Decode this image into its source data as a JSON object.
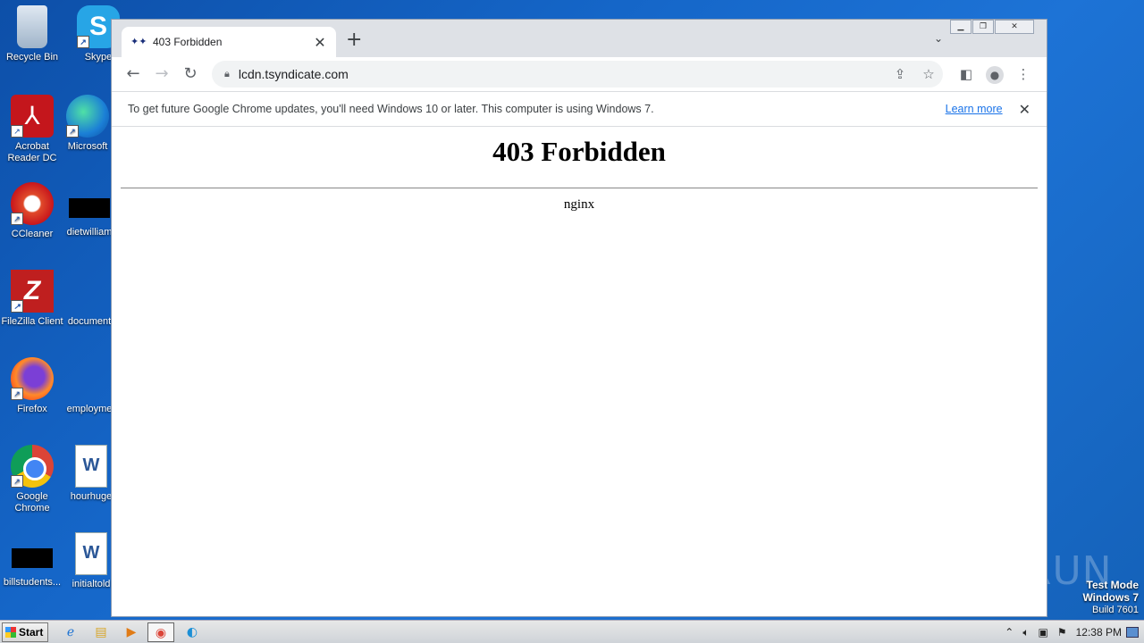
{
  "desktop": {
    "icons": [
      {
        "label": "Recycle Bin",
        "icon": "recycle-bin-icon"
      },
      {
        "label": "Skype",
        "icon": "skype-icon"
      },
      {
        "label": "Acrobat Reader DC",
        "icon": "acrobat-icon"
      },
      {
        "label": "Microsoft",
        "icon": "edge-icon"
      },
      {
        "label": "CCleaner",
        "icon": "ccleaner-icon"
      },
      {
        "label": "dietwilliam",
        "icon": "file-icon"
      },
      {
        "label": "FileZilla Client",
        "icon": "filezilla-icon"
      },
      {
        "label": "document",
        "icon": "file-icon"
      },
      {
        "label": "Firefox",
        "icon": "firefox-icon"
      },
      {
        "label": "employme",
        "icon": "file-icon"
      },
      {
        "label": "Google Chrome",
        "icon": "chrome-icon"
      },
      {
        "label": "hourhuge",
        "icon": "word-doc-icon"
      },
      {
        "label": "billstudents...",
        "icon": "file-icon"
      },
      {
        "label": "initialtold",
        "icon": "word-doc-icon"
      }
    ],
    "watermark": "ANY RUN",
    "test_mode": {
      "line1": "Test Mode",
      "line2": "Windows 7",
      "line3": "Build 7601"
    }
  },
  "browser": {
    "tab": {
      "title": "403 Forbidden",
      "favicon": "tsyndicate-favicon"
    },
    "new_tab_label": "+",
    "url": "lcdn.tsyndicate.com",
    "infobar": {
      "text": "To get future Google Chrome updates, you'll need Windows 10 or later. This computer is using Windows 7.",
      "link": "Learn more"
    }
  },
  "page": {
    "heading": "403 Forbidden",
    "server": "nginx"
  },
  "taskbar": {
    "start_label": "Start",
    "clock": "12:38 PM",
    "apps": [
      "ie-icon",
      "explorer-icon",
      "media-player-icon",
      "chrome-icon",
      "edge-icon"
    ]
  }
}
